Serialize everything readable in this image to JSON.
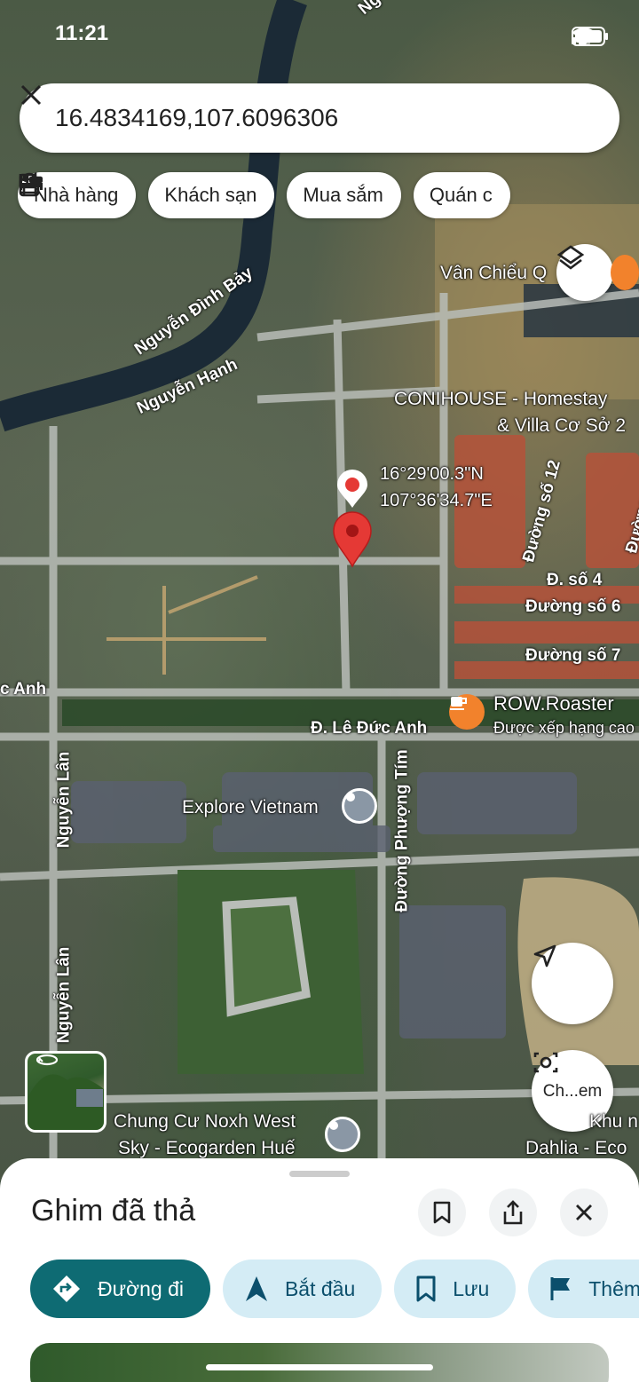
{
  "status": {
    "time": "11:21"
  },
  "search": {
    "query": "16.4834169,107.6096306"
  },
  "chips": [
    {
      "label": "Nhà hàng",
      "icon": "fork-knife-icon"
    },
    {
      "label": "Khách sạn",
      "icon": "bed-icon"
    },
    {
      "label": "Mua sắm",
      "icon": "shopping-bag-icon"
    },
    {
      "label": "Quán c",
      "icon": "coffee-cup-icon"
    }
  ],
  "map": {
    "pin_coords": {
      "lat": "16°29'00.3\"N",
      "lng": "107°36'34.7\"E"
    },
    "places": {
      "van_chieu": "Vân Chiểu Q",
      "conihouse_1": "CONIHOUSE - Homestay",
      "conihouse_2": "& Villa Cơ Sở 2",
      "row_roaster": "ROW.Roaster",
      "row_rating": "Được xếp hạng cao",
      "explore": "Explore Vietnam",
      "chungcu_1": "Chung Cư Noxh West",
      "chungcu_2": "Sky - Ecogarden Huế",
      "dahlia_1": "Khu n",
      "dahlia_2": "Dahlia - Eco"
    },
    "streets": {
      "nguyen_dinh_bay": "Nguyễn Đình Bảy",
      "nguyen_hanh": "Nguyễn Hạnh",
      "duong_so_12": "Đường số 12",
      "duong_so_1x": "Đường số 1",
      "d_so_4": "Đ. số 4",
      "duong_so_6": "Đường số 6",
      "duong_so_7": "Đường số 7",
      "duc_anh_left": "c Anh",
      "le_duc_anh": "Đ. Lê Đức Anh",
      "nguyen_lan_1": "Nguyễn Lân",
      "nguyen_lan_2": "Nguyễn Lân",
      "phuong_tim": "Đường Phượng Tím",
      "top_n": "Ng"
    },
    "camera_button_label": "Ch...em"
  },
  "sheet": {
    "title": "Ghim đã thả",
    "actions": [
      {
        "label": "Đường đi",
        "icon": "directions-icon",
        "primary": true
      },
      {
        "label": "Bắt đầu",
        "icon": "navigate-arrow-icon",
        "primary": false
      },
      {
        "label": "Lưu",
        "icon": "bookmark-icon",
        "primary": false
      },
      {
        "label": "Thêm",
        "icon": "flag-icon",
        "primary": false
      }
    ]
  },
  "colors": {
    "pin_red": "#e53935",
    "primary_action": "#0e6b73",
    "secondary_action_bg": "#d4ecf5",
    "poi_orange": "#f2822c",
    "poi_gray": "#8a97a5"
  }
}
